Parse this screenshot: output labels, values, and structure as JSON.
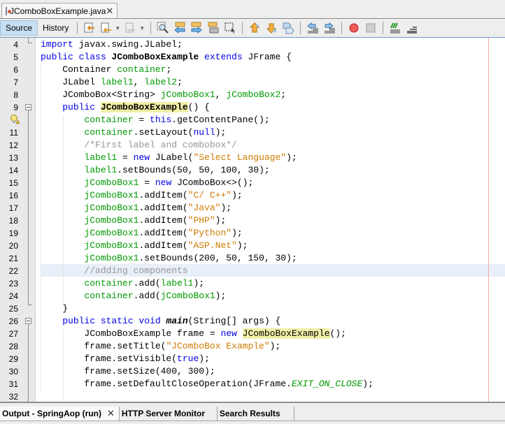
{
  "file_tab": {
    "label": "JComboBoxExample.java",
    "close": "✕"
  },
  "toolbar": {
    "source_label": "Source",
    "history_label": "History",
    "icons": [
      "last-edit-icon",
      "back-icon",
      "forward-icon",
      "find-icon",
      "find-previous-icon",
      "find-next-icon",
      "toggle-highlight-icon",
      "find-selection-icon",
      "previous-bookmark-icon",
      "next-bookmark-icon",
      "toggle-bookmark-icon",
      "shift-left-icon",
      "shift-right-icon",
      "start-macro-icon",
      "stop-macro-icon",
      "comment-icon",
      "uncomment-icon"
    ]
  },
  "editor": {
    "highlighted_line": 22,
    "lines": [
      {
        "n": "4",
        "tokens": [
          {
            "t": "import ",
            "c": "kw"
          },
          {
            "t": "javax.swing.JLabel;"
          }
        ]
      },
      {
        "n": "5",
        "tokens": [
          {
            "t": "public class ",
            "c": "kw"
          },
          {
            "t": "JComboBoxExample",
            "c": "bold"
          },
          {
            "t": " extends ",
            "c": "kw"
          },
          {
            "t": "JFrame {"
          }
        ]
      },
      {
        "n": "6",
        "tokens": [
          {
            "t": "    Container "
          },
          {
            "t": "container",
            "c": "fld"
          },
          {
            "t": ";"
          }
        ]
      },
      {
        "n": "7",
        "tokens": [
          {
            "t": "    JLabel "
          },
          {
            "t": "label1",
            "c": "fld"
          },
          {
            "t": ", "
          },
          {
            "t": "label2",
            "c": "fld"
          },
          {
            "t": ";"
          }
        ]
      },
      {
        "n": "8",
        "tokens": [
          {
            "t": "    JComboBox<String> "
          },
          {
            "t": "jComboBox1",
            "c": "fld"
          },
          {
            "t": ", "
          },
          {
            "t": "jComboBox2",
            "c": "fld"
          },
          {
            "t": ";"
          }
        ]
      },
      {
        "n": "9",
        "tokens": [
          {
            "t": "    "
          },
          {
            "t": "public ",
            "c": "kw"
          },
          {
            "t": "JComboBoxExample",
            "c": "bold mark"
          },
          {
            "t": "() {"
          }
        ]
      },
      {
        "n": "",
        "tokens": [
          {
            "t": "        "
          },
          {
            "t": "container",
            "c": "fld"
          },
          {
            "t": " = "
          },
          {
            "t": "this",
            "c": "kw"
          },
          {
            "t": ".getContentPane();"
          }
        ]
      },
      {
        "n": "11",
        "tokens": [
          {
            "t": "        "
          },
          {
            "t": "container",
            "c": "fld"
          },
          {
            "t": ".setLayout("
          },
          {
            "t": "null",
            "c": "kw"
          },
          {
            "t": ");"
          }
        ]
      },
      {
        "n": "12",
        "tokens": [
          {
            "t": "        "
          },
          {
            "t": "/*First label and combobox*/",
            "c": "cmt"
          }
        ]
      },
      {
        "n": "13",
        "tokens": [
          {
            "t": "        "
          },
          {
            "t": "label1",
            "c": "fld"
          },
          {
            "t": " = "
          },
          {
            "t": "new ",
            "c": "kw"
          },
          {
            "t": "JLabel("
          },
          {
            "t": "\"Select Language\"",
            "c": "str"
          },
          {
            "t": ");"
          }
        ]
      },
      {
        "n": "14",
        "tokens": [
          {
            "t": "        "
          },
          {
            "t": "label1",
            "c": "fld"
          },
          {
            "t": ".setBounds(50, 50, 100, 30);"
          }
        ]
      },
      {
        "n": "15",
        "tokens": [
          {
            "t": "        "
          },
          {
            "t": "jComboBox1",
            "c": "fld"
          },
          {
            "t": " = "
          },
          {
            "t": "new ",
            "c": "kw"
          },
          {
            "t": "JComboBox<>();"
          }
        ]
      },
      {
        "n": "16",
        "tokens": [
          {
            "t": "        "
          },
          {
            "t": "jComboBox1",
            "c": "fld"
          },
          {
            "t": ".addItem("
          },
          {
            "t": "\"C/ C++\"",
            "c": "str"
          },
          {
            "t": ");"
          }
        ]
      },
      {
        "n": "17",
        "tokens": [
          {
            "t": "        "
          },
          {
            "t": "jComboBox1",
            "c": "fld"
          },
          {
            "t": ".addItem("
          },
          {
            "t": "\"Java\"",
            "c": "str"
          },
          {
            "t": ");"
          }
        ]
      },
      {
        "n": "18",
        "tokens": [
          {
            "t": "        "
          },
          {
            "t": "jComboBox1",
            "c": "fld"
          },
          {
            "t": ".addItem("
          },
          {
            "t": "\"PHP\"",
            "c": "str"
          },
          {
            "t": ");"
          }
        ]
      },
      {
        "n": "19",
        "tokens": [
          {
            "t": "        "
          },
          {
            "t": "jComboBox1",
            "c": "fld"
          },
          {
            "t": ".addItem("
          },
          {
            "t": "\"Python\"",
            "c": "str"
          },
          {
            "t": ");"
          }
        ]
      },
      {
        "n": "20",
        "tokens": [
          {
            "t": "        "
          },
          {
            "t": "jComboBox1",
            "c": "fld"
          },
          {
            "t": ".addItem("
          },
          {
            "t": "\"ASP.Net\"",
            "c": "str"
          },
          {
            "t": ");"
          }
        ]
      },
      {
        "n": "21",
        "tokens": [
          {
            "t": "        "
          },
          {
            "t": "jComboBox1",
            "c": "fld"
          },
          {
            "t": ".setBounds(200, 50, 150, 30);"
          }
        ]
      },
      {
        "n": "22",
        "tokens": [
          {
            "t": "        "
          },
          {
            "t": "//adding components",
            "c": "cmt"
          }
        ]
      },
      {
        "n": "23",
        "tokens": [
          {
            "t": "        "
          },
          {
            "t": "container",
            "c": "fld"
          },
          {
            "t": ".add("
          },
          {
            "t": "label1",
            "c": "fld"
          },
          {
            "t": ");"
          }
        ]
      },
      {
        "n": "24",
        "tokens": [
          {
            "t": "        "
          },
          {
            "t": "container",
            "c": "fld"
          },
          {
            "t": ".add("
          },
          {
            "t": "jComboBox1",
            "c": "fld"
          },
          {
            "t": ");"
          }
        ]
      },
      {
        "n": "25",
        "tokens": [
          {
            "t": "    }"
          }
        ]
      },
      {
        "n": "26",
        "tokens": [
          {
            "t": "    "
          },
          {
            "t": "public static void ",
            "c": "kw"
          },
          {
            "t": "main",
            "c": "bold it"
          },
          {
            "t": "(String[] args) {"
          }
        ]
      },
      {
        "n": "27",
        "tokens": [
          {
            "t": "        JComboBoxExample frame = "
          },
          {
            "t": "new ",
            "c": "kw"
          },
          {
            "t": "JComboBoxExample",
            "c": "mark"
          },
          {
            "t": "();"
          }
        ]
      },
      {
        "n": "28",
        "tokens": [
          {
            "t": "        frame.setTitle("
          },
          {
            "t": "\"JComboBox Example\"",
            "c": "str"
          },
          {
            "t": ");"
          }
        ]
      },
      {
        "n": "29",
        "tokens": [
          {
            "t": "        frame.setVisible("
          },
          {
            "t": "true",
            "c": "kw"
          },
          {
            "t": ");"
          }
        ]
      },
      {
        "n": "30",
        "tokens": [
          {
            "t": "        frame.setSize(400, 300);"
          }
        ]
      },
      {
        "n": "31",
        "tokens": [
          {
            "t": "        frame.setDefaultCloseOperation(JFrame."
          },
          {
            "t": "EXIT_ON_CLOSE",
            "c": "fld it"
          },
          {
            "t": ");"
          }
        ]
      },
      {
        "n": "32",
        "tokens": []
      }
    ]
  },
  "bottom_tabs": [
    {
      "label": "Output - SpringAop (run)",
      "closable": true,
      "close": "✕"
    },
    {
      "label": "HTTP Server Monitor"
    },
    {
      "label": "Search Results"
    }
  ]
}
